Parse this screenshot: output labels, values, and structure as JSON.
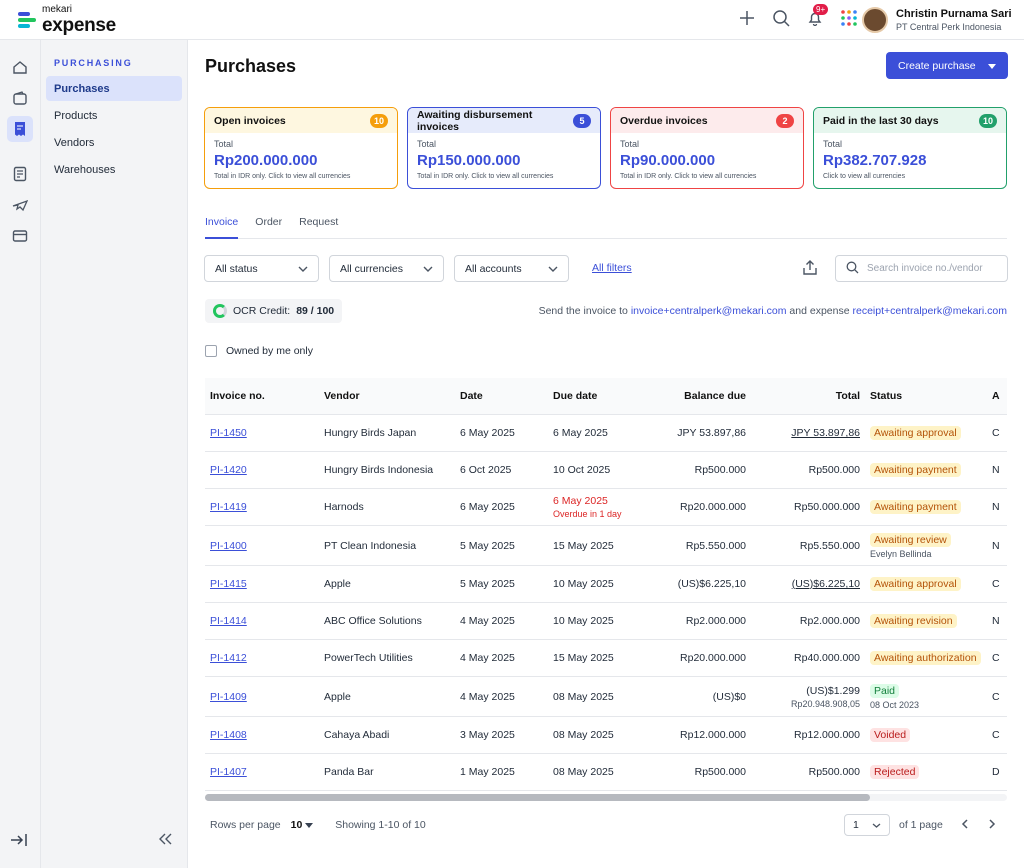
{
  "app": {
    "brand_small": "mekari",
    "brand_big": "expense"
  },
  "colors": {
    "accent": "#3b4fd8",
    "open": "#f59e0b",
    "awaiting": "#3b4fd8",
    "overdue": "#ef4444",
    "paid": "#22a06b"
  },
  "user": {
    "name": "Christin Purnama Sari",
    "company": "PT Central Perk Indonesia",
    "notif_count": "9+"
  },
  "sidebar": {
    "section": "PURCHASING",
    "items": [
      {
        "label": "Purchases"
      },
      {
        "label": "Products"
      },
      {
        "label": "Vendors"
      },
      {
        "label": "Warehouses"
      }
    ]
  },
  "page": {
    "title": "Purchases",
    "create_label": "Create purchase"
  },
  "cards": [
    {
      "title": "Open invoices",
      "count": "10",
      "total_label": "Total",
      "amount": "Rp200.000.000",
      "note": "Total in IDR only. Click to view all currencies"
    },
    {
      "title": "Awaiting disbursement invoices",
      "count": "5",
      "total_label": "Total",
      "amount": "Rp150.000.000",
      "note": "Total in IDR only. Click to view all currencies"
    },
    {
      "title": "Overdue invoices",
      "count": "2",
      "total_label": "Total",
      "amount": "Rp90.000.000",
      "note": "Total in IDR only. Click to view all currencies"
    },
    {
      "title": "Paid in the last 30 days",
      "count": "10",
      "total_label": "Total",
      "amount": "Rp382.707.928",
      "note": "Click to view all currencies"
    }
  ],
  "tabs": [
    {
      "label": "Invoice"
    },
    {
      "label": "Order"
    },
    {
      "label": "Request"
    }
  ],
  "filters": {
    "status": "All status",
    "currencies": "All currencies",
    "accounts": "All accounts",
    "all_filters": "All filters",
    "search_placeholder": "Search invoice no./vendor"
  },
  "ocr": {
    "label": "OCR Credit:",
    "value": "89 / 100"
  },
  "send": {
    "prefix": "Send the invoice to",
    "invoice_email": "invoice+centralperk@mekari.com",
    "middle": "and expense",
    "receipt_email": "receipt+centralperk@mekari.com"
  },
  "owned_label": "Owned by me only",
  "table": {
    "headers": {
      "invoice": "Invoice no.",
      "vendor": "Vendor",
      "date": "Date",
      "due": "Due date",
      "balance": "Balance due",
      "total": "Total",
      "status": "Status",
      "extra": "A"
    },
    "rows": [
      {
        "invoice": "PI-1450",
        "vendor": "Hungry Birds Japan",
        "date": "6 May 2025",
        "due": "6 May 2025",
        "due_sub": "",
        "balance": "JPY 53.897,86",
        "total": "JPY 53.897,86",
        "total_sub": "",
        "status": "Awaiting approval",
        "status_sub": "",
        "extra": "C"
      },
      {
        "invoice": "PI-1420",
        "vendor": "Hungry Birds Indonesia",
        "date": "6 Oct 2025",
        "due": "10 Oct 2025",
        "due_sub": "",
        "balance": "Rp500.000",
        "total": "Rp500.000",
        "total_sub": "",
        "status": "Awaiting payment",
        "status_sub": "",
        "extra": "N"
      },
      {
        "invoice": "PI-1419",
        "vendor": "Harnods",
        "date": "6 May 2025",
        "due": "6 May 2025",
        "due_sub": "Overdue in 1 day",
        "balance": "Rp20.000.000",
        "total": "Rp50.000.000",
        "total_sub": "",
        "status": "Awaiting payment",
        "status_sub": "",
        "extra": "N"
      },
      {
        "invoice": "PI-1400",
        "vendor": "PT Clean Indonesia",
        "date": "5 May 2025",
        "due": "15 May 2025",
        "due_sub": "",
        "balance": "Rp5.550.000",
        "total": "Rp5.550.000",
        "total_sub": "",
        "status": "Awaiting review",
        "status_sub": "Evelyn Bellinda",
        "extra": "N"
      },
      {
        "invoice": "PI-1415",
        "vendor": "Apple",
        "date": "5 May 2025",
        "due": "10 May 2025",
        "due_sub": "",
        "balance": "(US)$6.225,10",
        "total": "(US)$6.225,10",
        "total_sub": "",
        "status": "Awaiting approval",
        "status_sub": "",
        "extra": "C"
      },
      {
        "invoice": "PI-1414",
        "vendor": "ABC Office Solutions",
        "date": "4 May 2025",
        "due": "10 May 2025",
        "due_sub": "",
        "balance": "Rp2.000.000",
        "total": "Rp2.000.000",
        "total_sub": "",
        "status": "Awaiting revision",
        "status_sub": "",
        "extra": "N"
      },
      {
        "invoice": "PI-1412",
        "vendor": "PowerTech Utilities",
        "date": "4 May 2025",
        "due": "15 May 2025",
        "due_sub": "",
        "balance": "Rp20.000.000",
        "total": "Rp40.000.000",
        "total_sub": "",
        "status": "Awaiting authorization",
        "status_sub": "",
        "extra": "C"
      },
      {
        "invoice": "PI-1409",
        "vendor": "Apple",
        "date": "4 May 2025",
        "due": "08 May 2025",
        "due_sub": "",
        "balance": "(US)$0",
        "total": "(US)$1.299",
        "total_sub": "Rp20.948.908,05",
        "status": "Paid",
        "status_sub": "08 Oct 2023",
        "extra": "C"
      },
      {
        "invoice": "PI-1408",
        "vendor": "Cahaya Abadi",
        "date": "3 May 2025",
        "due": "08 May 2025",
        "due_sub": "",
        "balance": "Rp12.000.000",
        "total": "Rp12.000.000",
        "total_sub": "",
        "status": "Voided",
        "status_sub": "",
        "extra": "C"
      },
      {
        "invoice": "PI-1407",
        "vendor": "Panda Bar",
        "date": "1 May 2025",
        "due": "08 May 2025",
        "due_sub": "",
        "balance": "Rp500.000",
        "total": "Rp500.000",
        "total_sub": "",
        "status": "Rejected",
        "status_sub": "",
        "extra": "D"
      }
    ]
  },
  "pagination": {
    "rows_label": "Rows per page",
    "rows_value": "10",
    "showing": "Showing 1-10 of 10",
    "page": "1",
    "of_pages": "of 1 page"
  }
}
